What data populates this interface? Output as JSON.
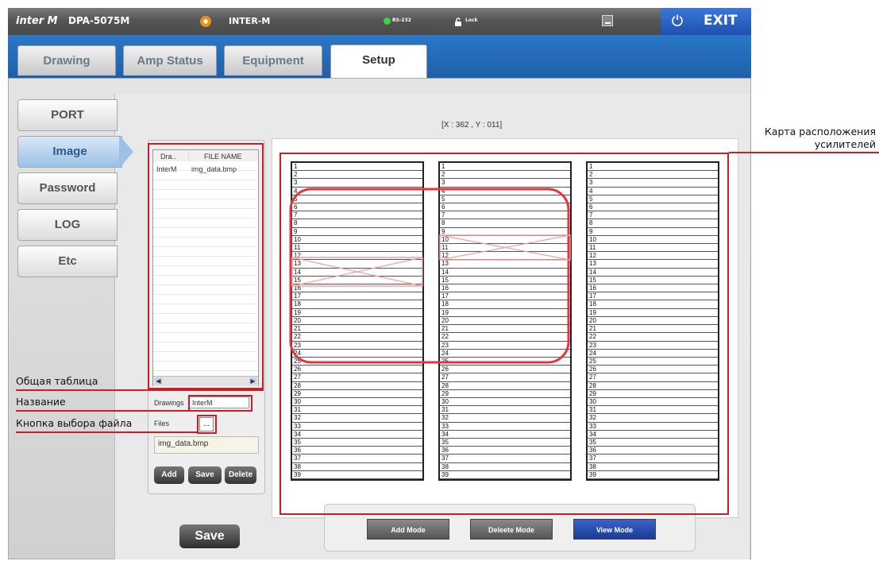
{
  "topbar": {
    "logo": "inter M",
    "model": "DPA-5075M",
    "system_name": "INTER-M",
    "rs232_label": "RS-232",
    "lock_label": "Lock",
    "exit_label": "EXIT"
  },
  "tabs": [
    {
      "label": "Drawing"
    },
    {
      "label": "Amp Status"
    },
    {
      "label": "Equipment"
    },
    {
      "label": "Setup"
    }
  ],
  "sidebar": {
    "items": [
      {
        "label": "PORT"
      },
      {
        "label": "Image"
      },
      {
        "label": "Password"
      },
      {
        "label": "LOG"
      },
      {
        "label": "Etc"
      }
    ]
  },
  "coords": "[X : 362 , Y : 011]",
  "file_list": {
    "col1": "Dra..",
    "col2": "FILE NAME",
    "rows": [
      {
        "c1": "InterM",
        "c2": "img_data.bmp"
      }
    ]
  },
  "form": {
    "drawings_label": "Drawings",
    "drawings_value": "InterM",
    "files_label": "Files",
    "browse_label": "...",
    "file_path": "img_data.bmp",
    "add_label": "Add",
    "save_label": "Save",
    "delete_label": "Delete"
  },
  "save_main_label": "Save",
  "modes": {
    "add": "Add Mode",
    "delete": "Deleete Mode",
    "view": "View Mode"
  },
  "racks": {
    "rows": [
      "1",
      "2",
      "3",
      "4",
      "5",
      "6",
      "7",
      "8",
      "9",
      "10",
      "11",
      "12",
      "13",
      "14",
      "15",
      "16",
      "17",
      "18",
      "19",
      "20",
      "21",
      "22",
      "23",
      "24",
      "25",
      "26",
      "27",
      "28",
      "29",
      "30",
      "31",
      "32",
      "33",
      "34",
      "35",
      "36",
      "37",
      "38",
      "39"
    ]
  },
  "callouts": {
    "general_table": "Общая таблица",
    "name": "Название",
    "file_button": "Кнопка выбора файла",
    "map_line1": "Карта расположения",
    "map_line2": "усилителей"
  },
  "colors": {
    "accent_blue": "#1e5ea8",
    "annotation_red": "#c81e2a"
  }
}
